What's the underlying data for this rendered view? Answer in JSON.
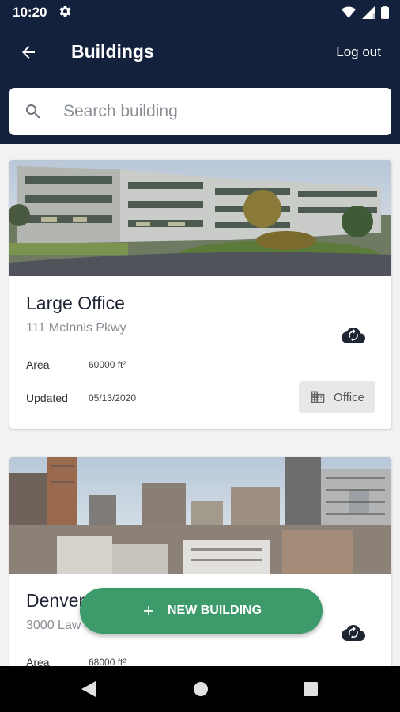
{
  "status_bar": {
    "time": "10:20"
  },
  "app_bar": {
    "title": "Buildings",
    "logout_label": "Log out"
  },
  "search": {
    "placeholder": "Search building",
    "value": ""
  },
  "buildings": [
    {
      "name": "Large Office",
      "address": "111 McInnis Pkwy",
      "area_label": "Area",
      "area_value": "60000 ft²",
      "updated_label": "Updated",
      "updated_value": "05/13/2020",
      "type": "Office"
    },
    {
      "name": "Denver",
      "address": "3000 Law",
      "area_label": "Area",
      "area_value": "68000 ft²"
    }
  ],
  "fab": {
    "label": "NEW BUILDING"
  },
  "icons": {
    "back": "arrow-left-icon",
    "search": "search-icon",
    "cloud": "cloud-sync-icon",
    "building": "building-icon",
    "add": "plus-icon"
  },
  "colors": {
    "app_bar": "#13213d",
    "fab": "#3d9a6a",
    "background": "#f2f2f2"
  }
}
